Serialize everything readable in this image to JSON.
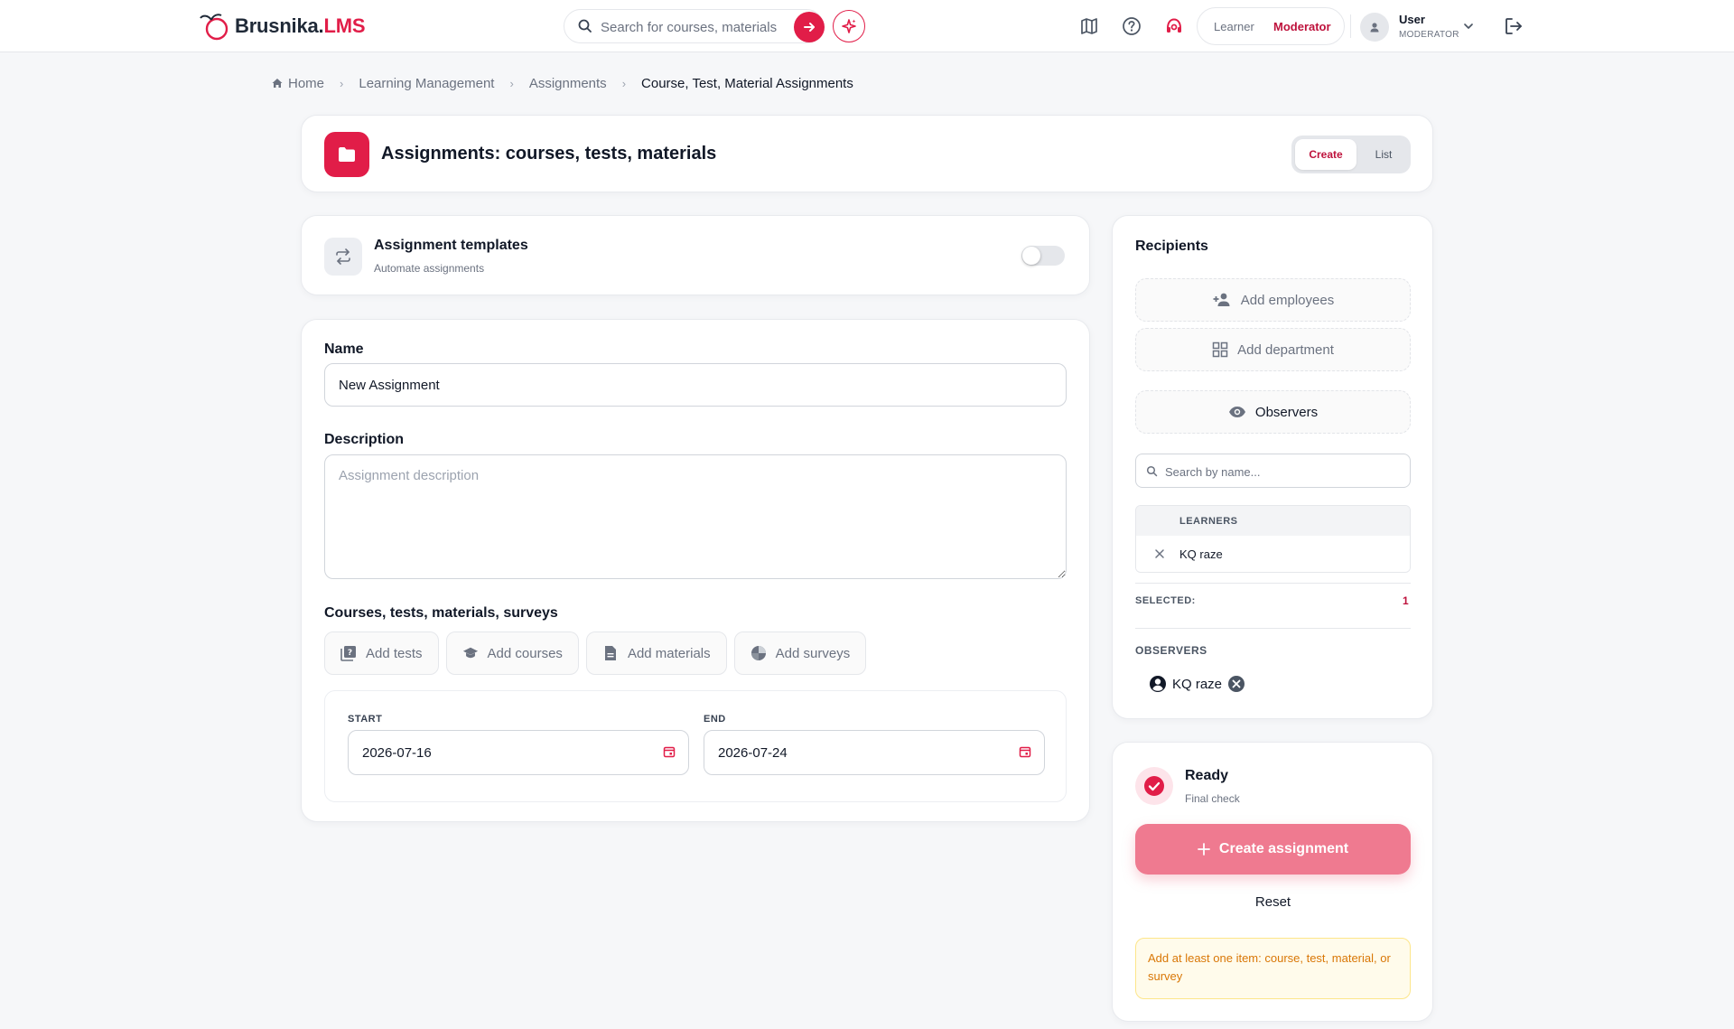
{
  "header": {
    "logo_main": "Brusnika.",
    "logo_accent": "LMS",
    "search_placeholder": "Search for courses, materials and more",
    "role_learner": "Learner",
    "role_moderator": "Moderator",
    "user_name": "User",
    "user_role": "MODERATOR",
    "icons": [
      "map-icon",
      "help-icon",
      "support-headset-icon",
      "logout-icon"
    ],
    "accent_color": "#e11d48"
  },
  "breadcrumb": {
    "home": "Home",
    "items": [
      "Learning Management",
      "Assignments"
    ],
    "current": "Course, Test, Material Assignments"
  },
  "title_card": {
    "title": "Assignments: courses, tests, materials",
    "tab_create": "Create",
    "tab_list": "List",
    "active_tab": "Create"
  },
  "templates": {
    "title": "Assignment templates",
    "subtitle": "Automate assignments",
    "enabled": false
  },
  "form": {
    "name_label": "Name",
    "name_value": "New Assignment",
    "description_label": "Description",
    "description_placeholder": "Assignment description",
    "items_label": "Courses, tests, materials, surveys",
    "add_buttons": {
      "tests": "Add tests",
      "courses": "Add courses",
      "materials": "Add materials",
      "surveys": "Add surveys"
    },
    "start_label": "START",
    "start_value": "2026-07-16",
    "end_label": "END",
    "end_value": "2026-07-24"
  },
  "recipients": {
    "title": "Recipients",
    "add_employees": "Add employees",
    "add_department": "Add department",
    "observers_button": "Observers",
    "search_placeholder": "Search by name...",
    "learners_header": "LEARNERS",
    "learners": [
      "KQ raze"
    ],
    "selected_label": "SELECTED:",
    "selected_count": "1",
    "observers_label": "OBSERVERS",
    "observers": [
      "KQ raze"
    ]
  },
  "ready": {
    "title": "Ready",
    "subtitle": "Final check",
    "create_button": "Create assignment",
    "reset_button": "Reset",
    "warning": "Add at least one item: course, test, material, or survey"
  }
}
